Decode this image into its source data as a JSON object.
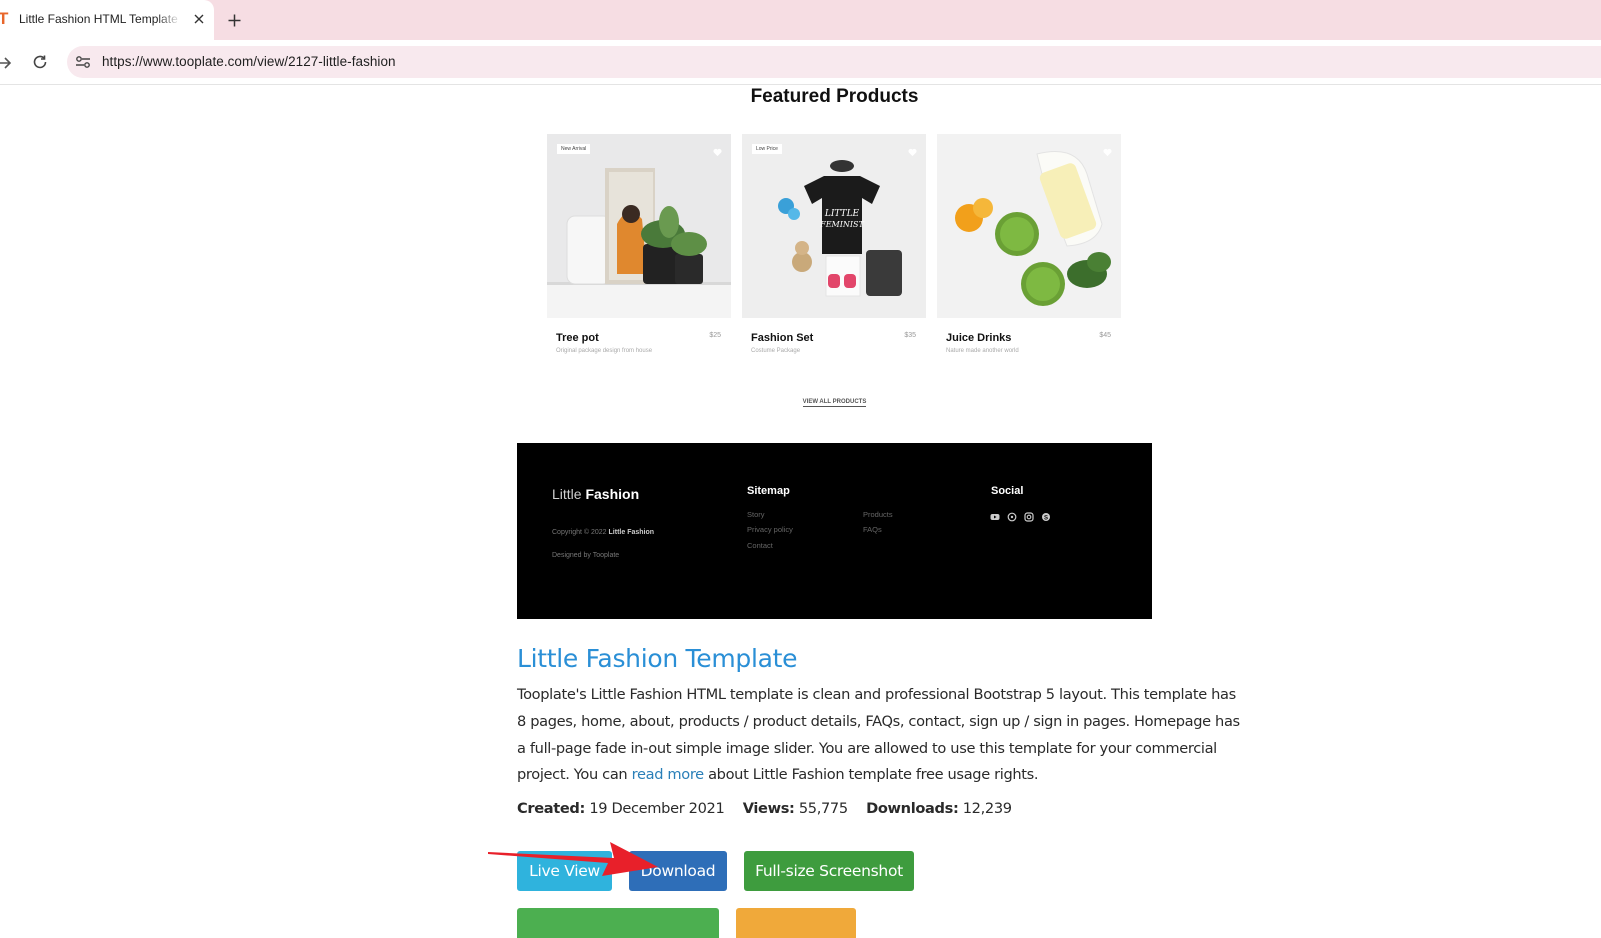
{
  "browser": {
    "tab_title": "Little Fashion HTML Template by Tooplate",
    "favicon_letter": "T",
    "url": "https://www.tooplate.com/view/2127-little-fashion"
  },
  "featured": {
    "title": "Featured Products",
    "products": [
      {
        "name": "Tree pot",
        "price": "$25",
        "desc": "Original package design from house",
        "badge": "New Arrival"
      },
      {
        "name": "Fashion Set",
        "price": "$35",
        "desc": "Costume Package",
        "badge": "Low Price"
      },
      {
        "name": "Juice Drinks",
        "price": "$45",
        "desc": "Nature made another world",
        "badge": ""
      }
    ],
    "view_all": "VIEW ALL PRODUCTS"
  },
  "footer": {
    "brand_light": "Little",
    "brand_bold": "Fashion",
    "copyright": "Copyright © 2022",
    "copyright_brand": "Little Fashion",
    "designed": "Designed by Tooplate",
    "sitemap_title": "Sitemap",
    "sitemap": [
      "Story",
      "Privacy policy",
      "Contact",
      "Products",
      "FAQs"
    ],
    "social_title": "Social",
    "social_icons": [
      "youtube-icon",
      "whatsapp-icon",
      "instagram-icon",
      "skype-icon"
    ]
  },
  "template": {
    "title": "Little Fashion Template",
    "desc_before": "Tooplate's Little Fashion HTML template is clean and professional Bootstrap 5 layout. This template has 8 pages, home, about, products / product details, FAQs, contact, sign up / sign in pages. Homepage has a full-page fade in-out simple image slider. You are allowed to use this template for your commercial project. You can ",
    "desc_link": "read more",
    "desc_after": " about Little Fashion template free usage rights.",
    "created_label": "Created:",
    "created": "19 December 2021",
    "views_label": "Views:",
    "views": "55,775",
    "downloads_label": "Downloads:",
    "downloads": "12,239"
  },
  "buttons": {
    "live_view": "Live View",
    "download": "Download",
    "screenshot": "Full-size Screenshot"
  },
  "colors": {
    "tab_strip": "#f6dde3",
    "link_blue": "#2a8fd6",
    "live_view": "#2fb3dd",
    "download": "#2e6eb8",
    "screenshot": "#3e9c3e",
    "annotation_arrow": "#e8202a"
  }
}
